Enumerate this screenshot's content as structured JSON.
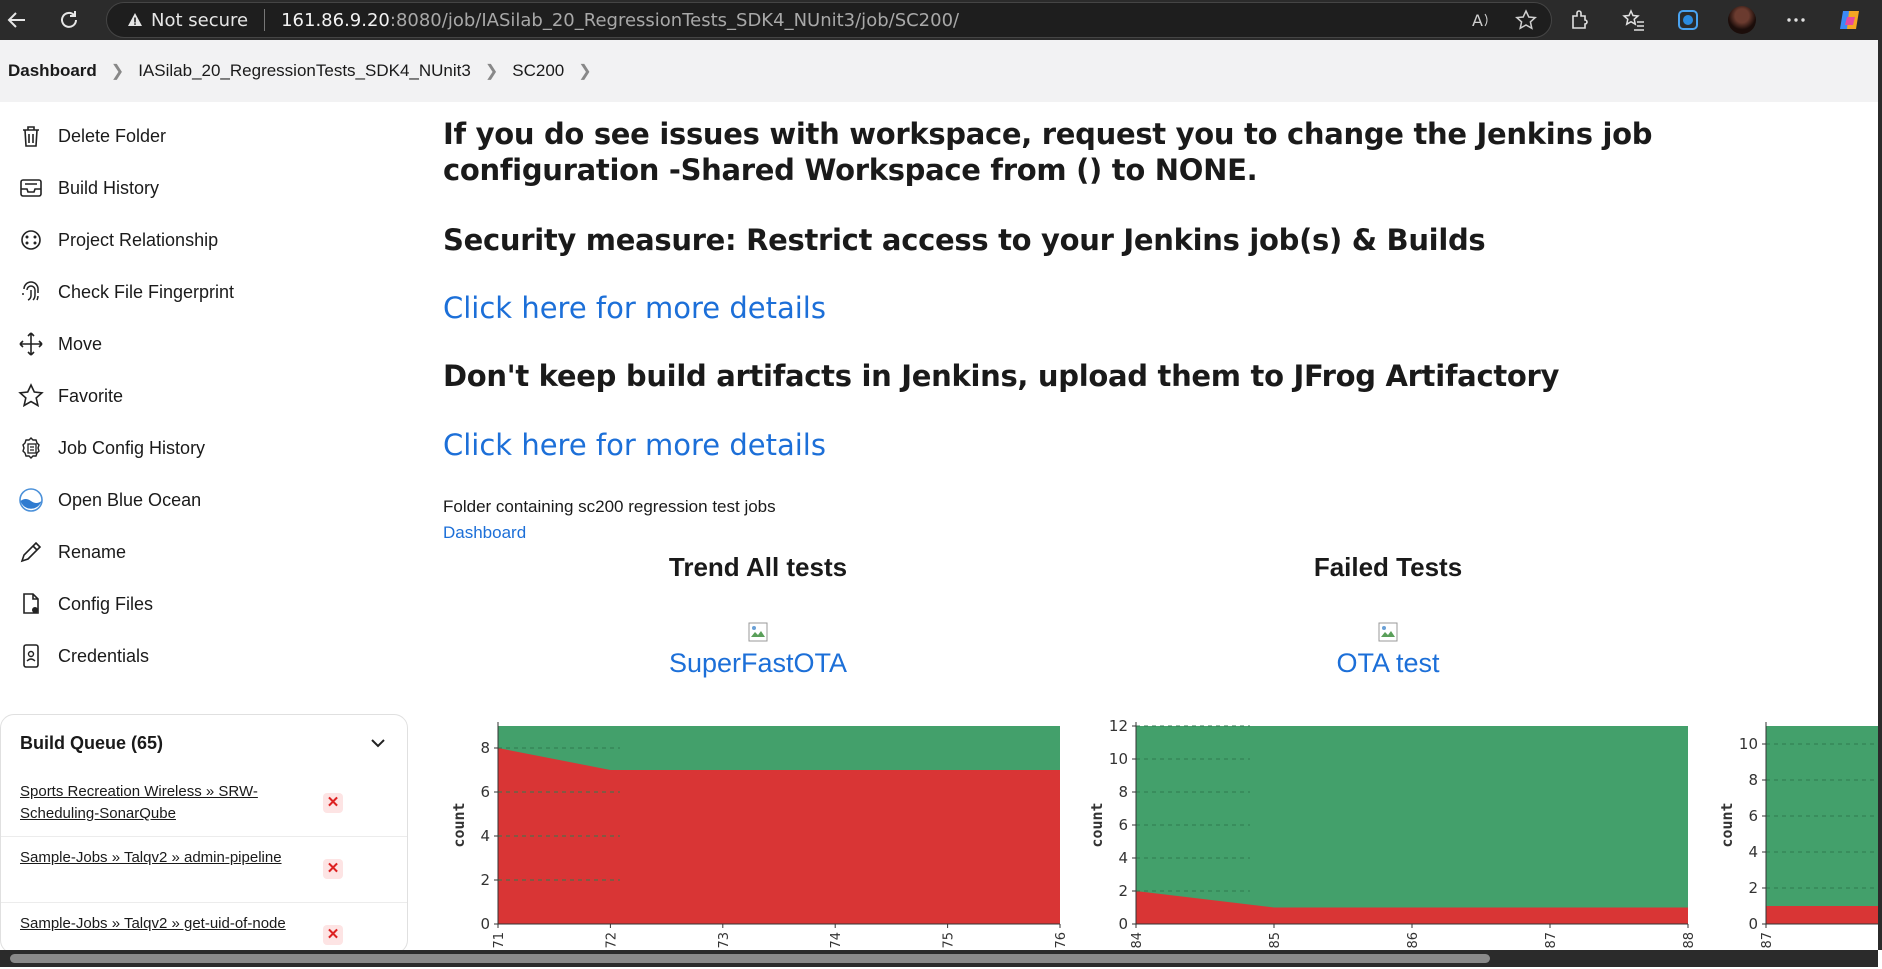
{
  "browser": {
    "security_label": "Not secure",
    "url_host": "161.86.9.20",
    "url_rest": ":8080/job/IASilab_20_RegressionTests_SDK4_NUnit3/job/SC200/"
  },
  "breadcrumb": [
    "Dashboard",
    "IASilab_20_RegressionTests_SDK4_NUnit3",
    "SC200"
  ],
  "sidebar": {
    "items": [
      {
        "label": "Delete Folder",
        "icon": "trash-icon"
      },
      {
        "label": "Build History",
        "icon": "inbox-icon"
      },
      {
        "label": "Project Relationship",
        "icon": "relationship-icon"
      },
      {
        "label": "Check File Fingerprint",
        "icon": "fingerprint-icon"
      },
      {
        "label": "Move",
        "icon": "move-icon"
      },
      {
        "label": "Favorite",
        "icon": "star-icon"
      },
      {
        "label": "Job Config History",
        "icon": "config-history-icon"
      },
      {
        "label": "Open Blue Ocean",
        "icon": "blue-ocean-icon"
      },
      {
        "label": "Rename",
        "icon": "pencil-icon"
      },
      {
        "label": "Config Files",
        "icon": "config-files-icon"
      },
      {
        "label": "Credentials",
        "icon": "credentials-icon"
      }
    ]
  },
  "queue": {
    "title": "Build Queue (65)",
    "items": [
      "Sports Recreation Wireless » SRW-Scheduling-SonarQube",
      "Sample-Jobs » Talqv2 » admin-pipeline",
      "Sample-Jobs » Talqv2 » get-uid-of-node"
    ]
  },
  "main": {
    "notice1": "If you do see issues with workspace, request you to change the Jenkins job configuration -Shared Workspace from () to NONE.",
    "notice2": "Security measure: Restrict access to your Jenkins job(s) & Builds",
    "link1": "Click here for more details",
    "notice3": "Don't keep build artifacts in Jenkins, upload them to JFrog Artifactory",
    "link2": "Click here for more details",
    "description": "Folder containing sc200 regression test jobs",
    "dashboard_link": "Dashboard",
    "col1_title": "Trend All tests",
    "col2_title": "Failed Tests",
    "col1_link": "SuperFastOTA",
    "col2_link": "OTA test"
  },
  "chart_data": [
    {
      "type": "area",
      "ylabel": "count",
      "x": [
        "71",
        "72",
        "73",
        "74",
        "75",
        "76"
      ],
      "ylim": [
        0,
        9
      ],
      "yticks": [
        0,
        2,
        4,
        6,
        8
      ],
      "series": [
        {
          "values": [
            8,
            7,
            7,
            7,
            7,
            7
          ],
          "color": "#d93535"
        },
        {
          "values": [
            9,
            9,
            9,
            9,
            9,
            9
          ],
          "color": "#43a06b"
        }
      ]
    },
    {
      "type": "area",
      "ylabel": "count",
      "x": [
        "84",
        "85",
        "86",
        "87",
        "88"
      ],
      "ylim": [
        0,
        12
      ],
      "yticks": [
        0,
        2,
        4,
        6,
        8,
        10,
        12
      ],
      "series": [
        {
          "values": [
            2,
            1,
            1,
            1,
            1
          ],
          "color": "#d93535"
        },
        {
          "values": [
            12,
            12,
            12,
            12,
            12
          ],
          "color": "#43a06b"
        }
      ]
    },
    {
      "type": "area",
      "ylabel": "count",
      "x": [
        "87"
      ],
      "ylim": [
        0,
        11
      ],
      "yticks": [
        0,
        2,
        4,
        6,
        8,
        10
      ],
      "series": [
        {
          "values": [
            1,
            1
          ],
          "color": "#d93535"
        },
        {
          "values": [
            11,
            11
          ],
          "color": "#43a06b"
        }
      ]
    }
  ]
}
